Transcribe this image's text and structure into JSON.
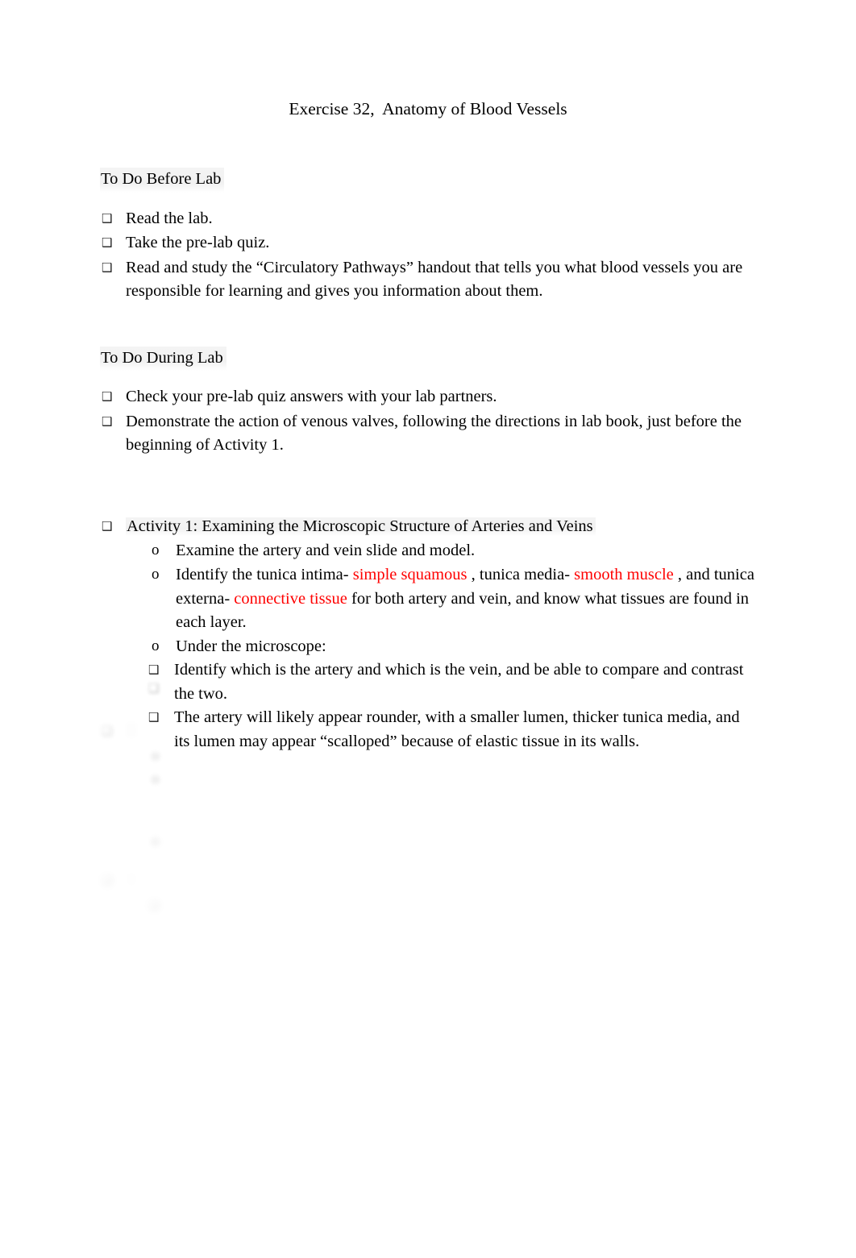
{
  "document": {
    "title": "Exercise 32,  Anatomy of Blood Vessels",
    "background_color": "#ffffff",
    "text_color": "#000000",
    "accent_color": "#FF0000",
    "highlight_color": "#EAEAEA"
  },
  "markers": {
    "level1_bullet": "❑",
    "level2_bullet": "o",
    "level3_bullet": "❑"
  },
  "sections": [
    {
      "heading": "To Do Before Lab",
      "items": [
        {
          "text": "Read the lab."
        },
        {
          "text": "Take the pre-lab quiz."
        },
        {
          "text": "Read and study the “Circulatory Pathways” handout that tells you what blood vessels you are responsible for learning and gives you information about them."
        }
      ]
    },
    {
      "heading": "To Do During Lab",
      "items": [
        {
          "text": "Check your pre-lab quiz answers with your lab partners."
        },
        {
          "text": "Demonstrate the action of venous valves, following the directions in lab book, just before the beginning of Activity 1."
        }
      ]
    }
  ],
  "activity1": {
    "heading": "Activity 1: Examining the Microscopic Structure of Arteries and Veins",
    "sub_items": [
      {
        "text": "Examine the artery and vein slide and model."
      },
      {
        "rich": true,
        "part1": "Identify the tunica intima- ",
        "red1": "simple squamous",
        "part2": " , tunica media- ",
        "red2": "smooth muscle",
        "part3": " , and tunica externa-  ",
        "red3": "connective tissue",
        "part4": " for both artery and vein, and know what tissues are found in each layer."
      },
      {
        "text": "Under the microscope:",
        "children": [
          {
            "text": "Identify which is the artery and which is the vein, and be able to compare and contrast the two."
          },
          {
            "text": "The artery will likely appear rounder, with a smaller lumen, thicker tunica media, and its lumen may appear “scalloped” because of elastic tissue in its walls."
          }
        ]
      }
    ]
  },
  "obscured": {
    "note": "Remaining content on the page is faded/blurred and not legible.",
    "lines": [
      " ",
      " ",
      " ",
      " ",
      " ",
      " ",
      " "
    ]
  }
}
